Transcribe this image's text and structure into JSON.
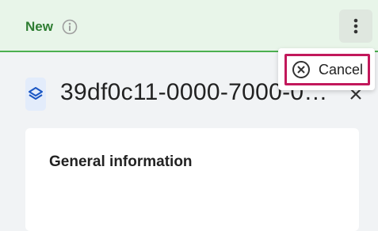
{
  "status": {
    "label": "New",
    "icon": "info-icon",
    "bar_color": "#e8f5e9",
    "accent_color": "#4caf50"
  },
  "header": {
    "icon": "layers-icon",
    "title": "39df0c11-0000-7000-0…"
  },
  "menu": {
    "button_icon": "more-vert-icon",
    "items": [
      {
        "label": "Cancel",
        "icon": "cancel-circle-icon"
      }
    ],
    "highlight_color": "#c2185b"
  },
  "card": {
    "section_title": "General information"
  }
}
